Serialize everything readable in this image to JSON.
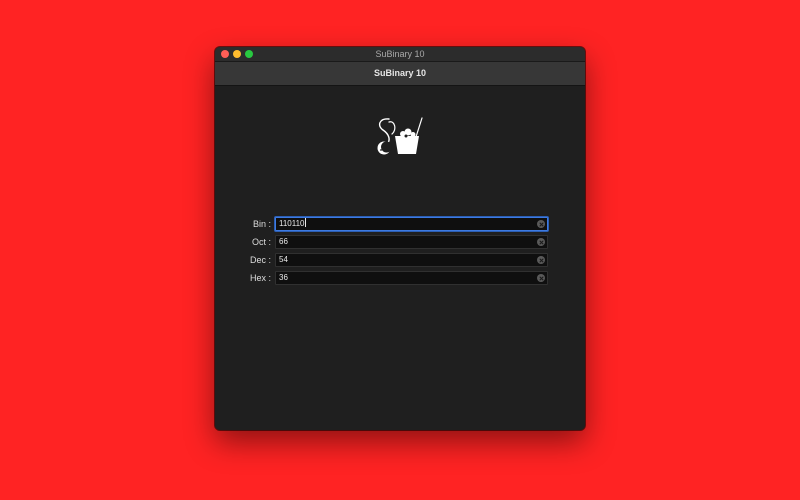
{
  "window": {
    "title": "SuBinary 10",
    "toolbar_title": "SuBinary 10"
  },
  "logo": {
    "icon": "subinary-logo-icon"
  },
  "converter": {
    "fields": [
      {
        "label": "Bin :",
        "value": "110110",
        "focused": true
      },
      {
        "label": "Oct :",
        "value": "66",
        "focused": false
      },
      {
        "label": "Dec :",
        "value": "54",
        "focused": false
      },
      {
        "label": "Hex :",
        "value": "36",
        "focused": false
      }
    ]
  },
  "colors": {
    "desktop": "#ff2323",
    "window_bg": "#1f1f1f",
    "field_bg": "#0f0f0f",
    "focus_ring": "#3d7ae2"
  }
}
